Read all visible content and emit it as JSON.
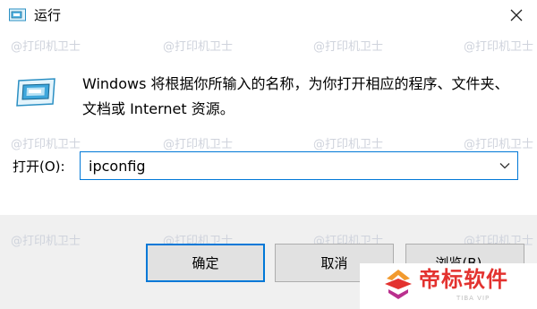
{
  "window": {
    "title": "运行",
    "icons": {
      "title": "run-dialog-icon",
      "close": "close-icon",
      "dropdown": "chevron-down-icon"
    }
  },
  "dialog": {
    "description": "Windows 将根据你所输入的名称，为你打开相应的程序、文件夹、文档或 Internet 资源。",
    "open_label": "打开(O):",
    "open_value": "ipconfig"
  },
  "buttons": {
    "ok": "确定",
    "cancel": "取消",
    "browse": "浏览(B)..."
  },
  "brand": {
    "name": "帝标软件",
    "sub": "TIBA VIP",
    "accent": "#e3322f"
  },
  "watermark": "@打印机卫士",
  "colors": {
    "focus": "#0078d7",
    "footer": "#f0f0f0",
    "button": "#e1e1e1"
  }
}
